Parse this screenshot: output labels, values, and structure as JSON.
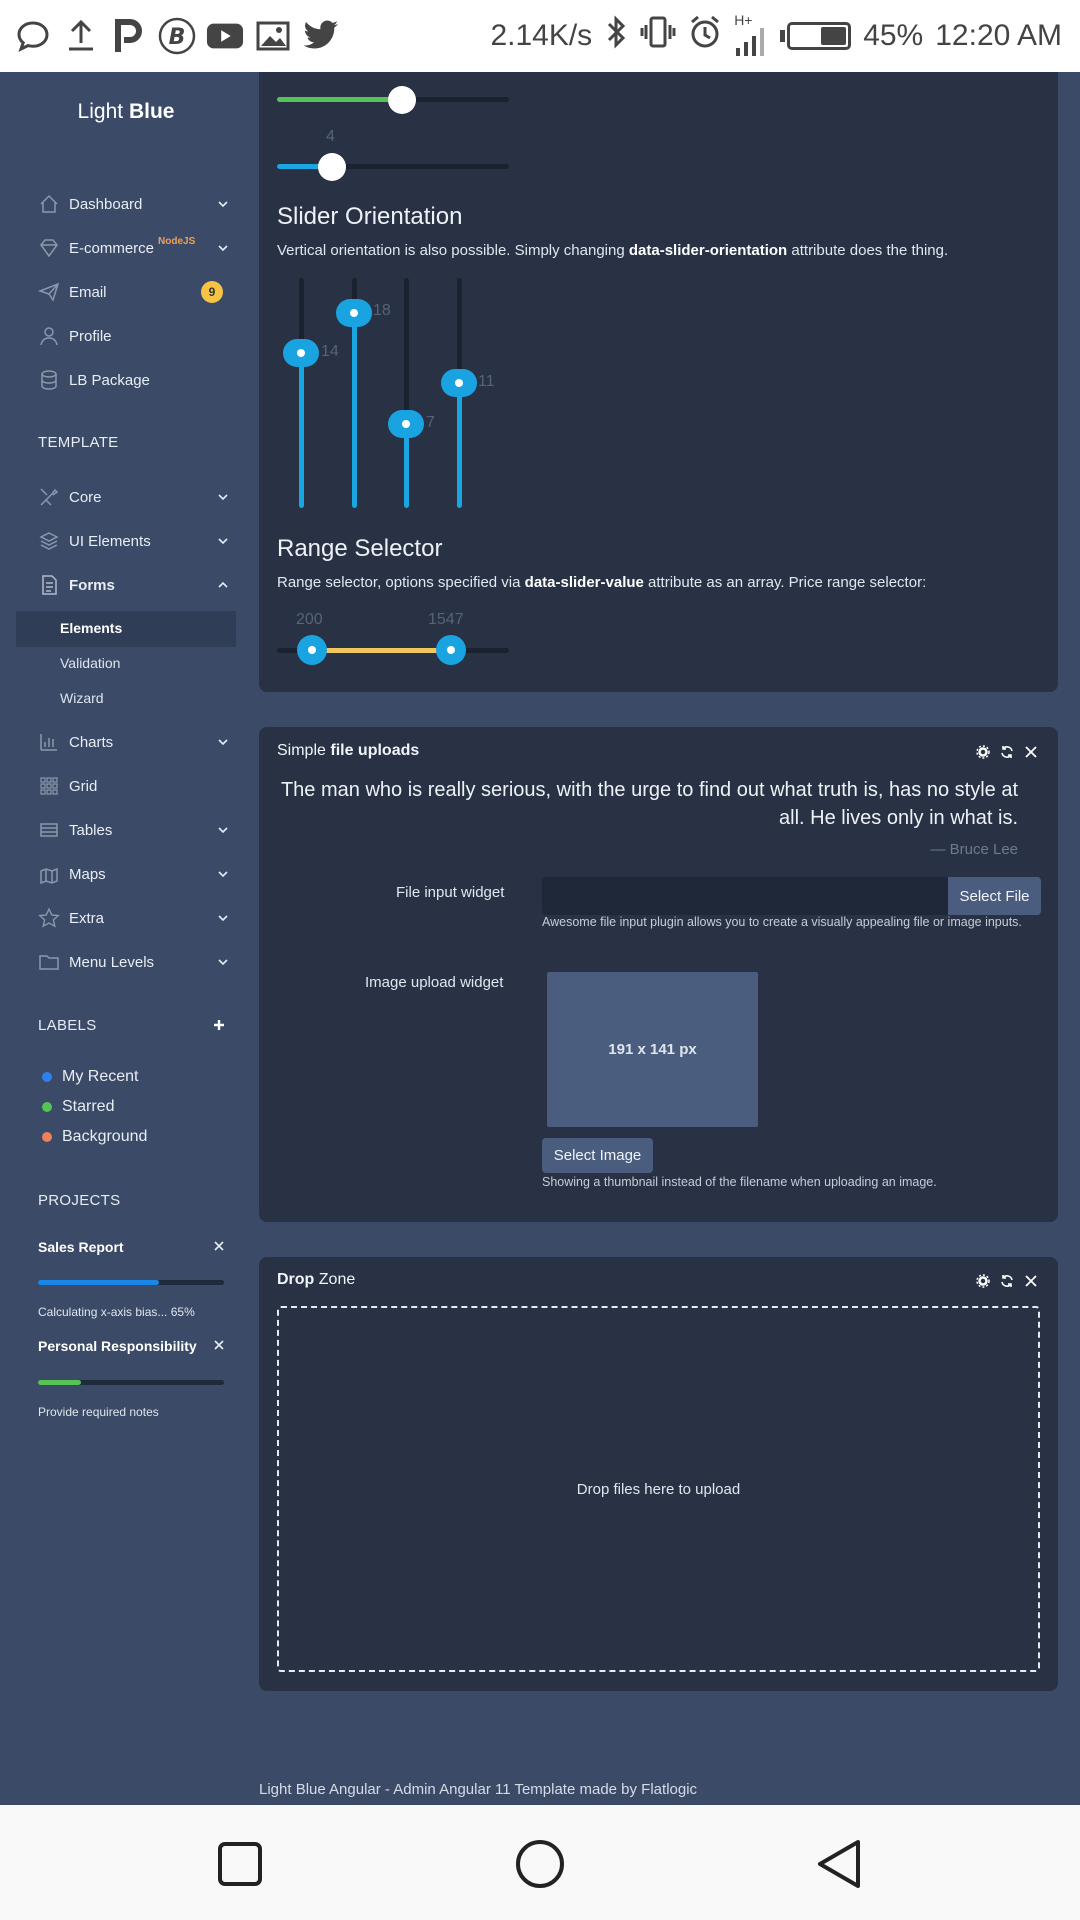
{
  "status_bar": {
    "net_speed": "2.14K/s",
    "network": "H+",
    "battery": "45%",
    "battery_level": 0.45,
    "time": "12:20 AM",
    "icons": [
      "message-icon",
      "upload-icon",
      "p-icon",
      "b-icon",
      "youtube-icon",
      "gallery-icon",
      "twitter-icon",
      "bluetooth-icon",
      "vibrate-icon",
      "alarm-icon",
      "signal-icon",
      "battery-icon"
    ]
  },
  "sidebar": {
    "logo_light": "Light",
    "logo_bold": "Blue",
    "items": [
      {
        "label": "Dashboard",
        "icon": "home-icon"
      },
      {
        "label": "E-commerce",
        "sup": "NodeJS",
        "icon": "diamond-icon"
      },
      {
        "label": "Email",
        "badge": "9",
        "icon": "paper-plane-icon"
      },
      {
        "label": "Profile",
        "icon": "user-icon"
      },
      {
        "label": "LB Package",
        "icon": "database-icon"
      }
    ],
    "template_title": "TEMPLATE",
    "template_items": [
      {
        "label": "Core",
        "icon": "tools-icon"
      },
      {
        "label": "UI Elements",
        "icon": "layers-icon"
      },
      {
        "label": "Forms",
        "icon": "form-icon"
      }
    ],
    "forms_sub": [
      "Elements",
      "Validation",
      "Wizard"
    ],
    "more_items": [
      {
        "label": "Charts",
        "icon": "chart-icon"
      },
      {
        "label": "Grid",
        "icon": "grid-icon"
      },
      {
        "label": "Tables",
        "icon": "table-icon"
      },
      {
        "label": "Maps",
        "icon": "map-icon"
      },
      {
        "label": "Extra",
        "icon": "star-icon"
      },
      {
        "label": "Menu Levels",
        "icon": "folder-icon"
      }
    ],
    "labels_title": "LABELS",
    "labels": [
      {
        "name": "My Recent",
        "color": "#2f80ed"
      },
      {
        "name": "Starred",
        "color": "#56c356"
      },
      {
        "name": "Background",
        "color": "#f07f5b"
      }
    ],
    "projects_title": "PROJECTS",
    "projects": [
      {
        "title": "Sales Report",
        "note": "Calculating x-axis bias... 65%",
        "progress": 0.65,
        "color": "#1a86e8"
      },
      {
        "title": "Personal Responsibility",
        "note": "Provide required notes",
        "progress": 0.23,
        "color": "#56c356"
      }
    ]
  },
  "sliders": {
    "top_value": 4,
    "orientation_title": "Slider Orientation",
    "orientation_desc_1": "Vertical orientation is also possible. Simply changing ",
    "orientation_desc_bold": "data-slider-orientation",
    "orientation_desc_2": " attribute does the thing.",
    "vertical_values": [
      "14",
      "18",
      "7",
      "11"
    ],
    "range_title": "Range Selector",
    "range_desc_1": "Range selector, options specified via ",
    "range_desc_bold": "data-slider-value",
    "range_desc_2": " attribute as an array. Price range selector:",
    "range_low": "200",
    "range_high": "1547"
  },
  "file_uploads": {
    "header_light": "Simple ",
    "header_bold": "file uploads",
    "quote": "The man who is really serious, with the urge to find out what truth is, has no style at all. He lives only in what is.",
    "quote_source": "— Bruce Lee",
    "file_label": "File input widget",
    "file_button": "Select File",
    "file_help": "Awesome file input plugin allows you to create a visually appealing file or image inputs.",
    "image_label": "Image upload widget",
    "thumb_text": "191 x 141 px",
    "image_button": "Select Image",
    "image_help": "Showing a thumbnail instead of the filename when uploading an image."
  },
  "drop_zone": {
    "header_bold": "Drop",
    "header_light": " Zone",
    "message": "Drop files here to upload"
  },
  "footer": "Light Blue Angular - Admin Angular 11 Template made by Flatlogic"
}
